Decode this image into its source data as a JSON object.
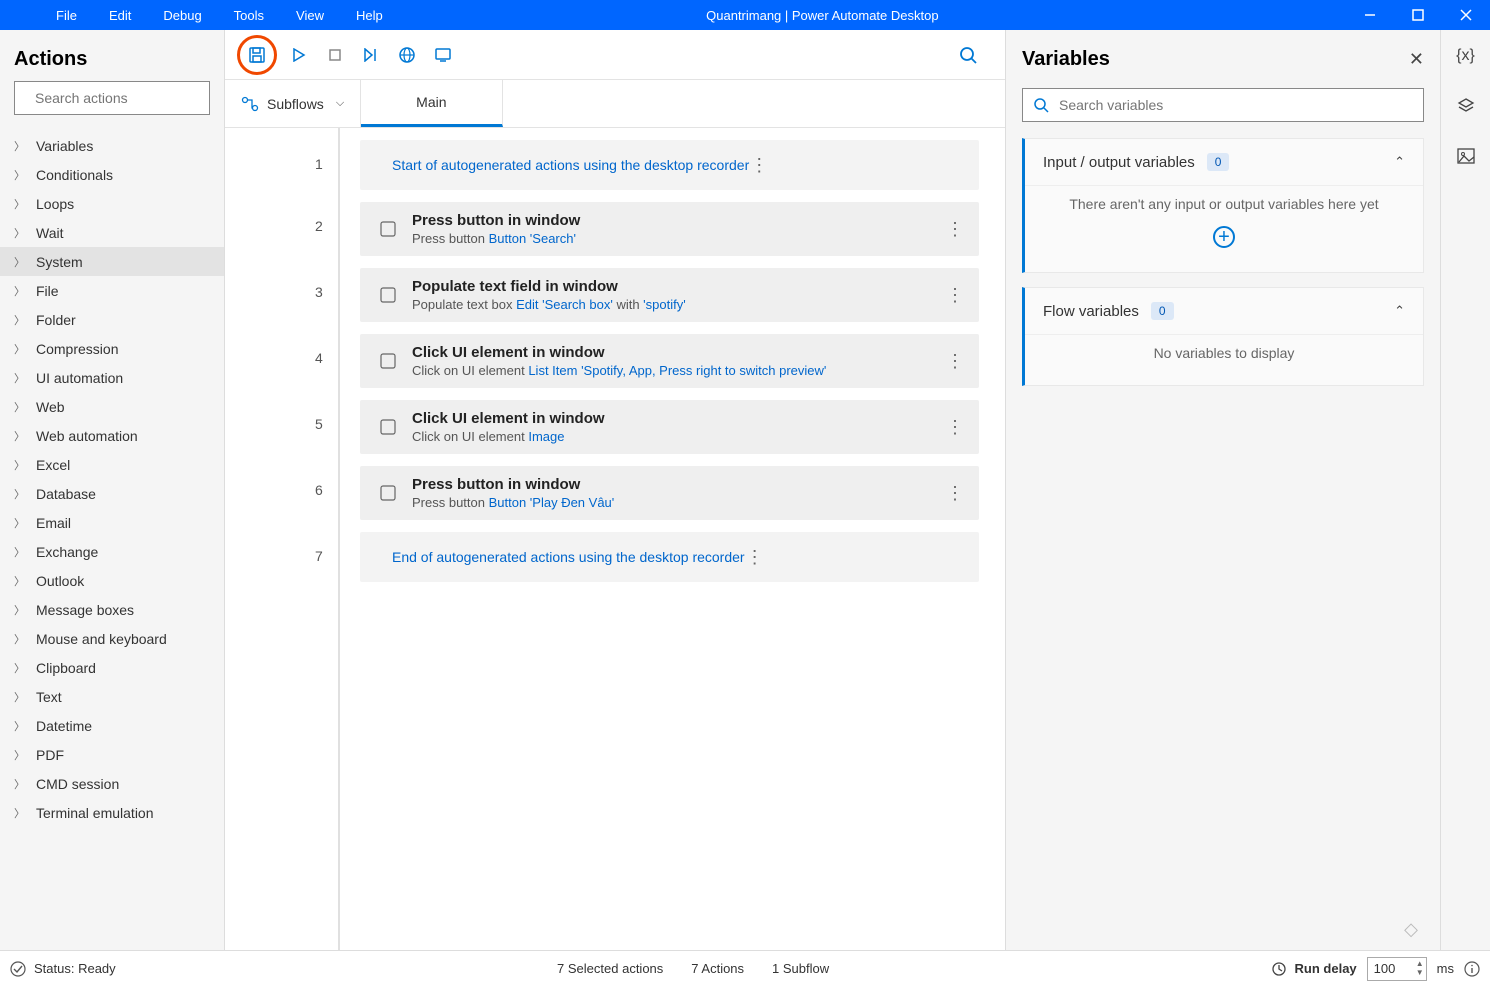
{
  "titlebar": {
    "menus": [
      "File",
      "Edit",
      "Debug",
      "Tools",
      "View",
      "Help"
    ],
    "title": "Quantrimang | Power Automate Desktop"
  },
  "actions": {
    "header": "Actions",
    "search_placeholder": "Search actions",
    "tree": [
      {
        "label": "Variables"
      },
      {
        "label": "Conditionals"
      },
      {
        "label": "Loops"
      },
      {
        "label": "Wait"
      },
      {
        "label": "System",
        "selected": true
      },
      {
        "label": "File"
      },
      {
        "label": "Folder"
      },
      {
        "label": "Compression"
      },
      {
        "label": "UI automation"
      },
      {
        "label": "Web"
      },
      {
        "label": "Web automation"
      },
      {
        "label": "Excel"
      },
      {
        "label": "Database"
      },
      {
        "label": "Email"
      },
      {
        "label": "Exchange"
      },
      {
        "label": "Outlook"
      },
      {
        "label": "Message boxes"
      },
      {
        "label": "Mouse and keyboard"
      },
      {
        "label": "Clipboard"
      },
      {
        "label": "Text"
      },
      {
        "label": "Datetime"
      },
      {
        "label": "PDF"
      },
      {
        "label": "CMD session"
      },
      {
        "label": "Terminal emulation"
      }
    ]
  },
  "subflows": {
    "label": "Subflows",
    "tab": "Main"
  },
  "steps": [
    {
      "num": "1",
      "auto": "Start of autogenerated actions using the desktop recorder"
    },
    {
      "num": "2",
      "title": "Press button in window",
      "sub_pre": "Press button ",
      "sub_link": "Button 'Search'"
    },
    {
      "num": "3",
      "title": "Populate text field in window",
      "sub_pre": "Populate text box ",
      "sub_link": "Edit 'Search box'",
      "sub_mid": " with ",
      "sub_link2": "'spotify'"
    },
    {
      "num": "4",
      "title": "Click UI element in window",
      "sub_pre": "Click on UI element ",
      "sub_link": "List Item 'Spotify, App, Press right to switch preview'"
    },
    {
      "num": "5",
      "title": "Click UI element in window",
      "sub_pre": "Click on UI element ",
      "sub_link": "Image"
    },
    {
      "num": "6",
      "title": "Press button in window",
      "sub_pre": "Press button ",
      "sub_link": "Button 'Play Đen Vâu'"
    },
    {
      "num": "7",
      "auto": "End of autogenerated actions using the desktop recorder"
    }
  ],
  "variables": {
    "header": "Variables",
    "search_placeholder": "Search variables",
    "io_label": "Input / output variables",
    "io_count": "0",
    "io_empty": "There aren't any input or output variables here yet",
    "flow_label": "Flow variables",
    "flow_count": "0",
    "flow_empty": "No variables to display"
  },
  "status": {
    "ready": "Status: Ready",
    "selected": "7 Selected actions",
    "actions": "7 Actions",
    "subflow": "1 Subflow",
    "run_delay": "Run delay",
    "delay_val": "100",
    "ms": "ms"
  }
}
